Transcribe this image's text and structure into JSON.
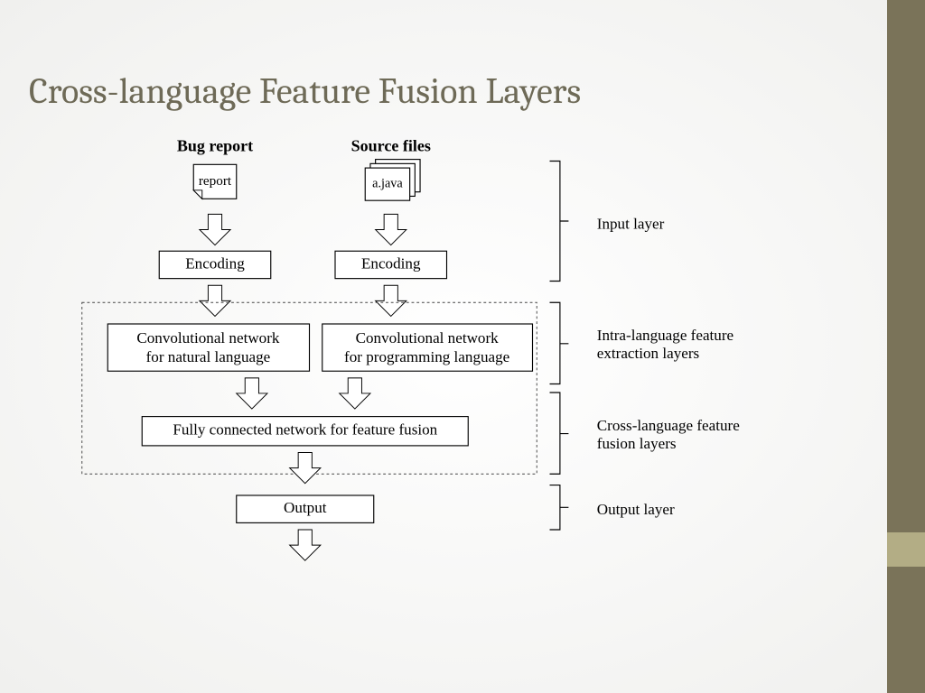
{
  "title": "Cross-language Feature Fusion Layers",
  "inputs": {
    "left_header": "Bug report",
    "left_doc": "report",
    "right_header": "Source files",
    "right_doc": "a.java"
  },
  "boxes": {
    "encoding_left": "Encoding",
    "encoding_right": "Encoding",
    "conv_left_l1": "Convolutional network",
    "conv_left_l2": "for natural language",
    "conv_right_l1": "Convolutional network",
    "conv_right_l2": "for programming language",
    "fusion": "Fully connected network for feature fusion",
    "output": "Output"
  },
  "brackets": {
    "input": "Input layer",
    "intra_l1": "Intra-language feature",
    "intra_l2": "extraction layers",
    "cross_l1": "Cross-language feature",
    "cross_l2": "fusion layers",
    "output": "Output layer"
  }
}
